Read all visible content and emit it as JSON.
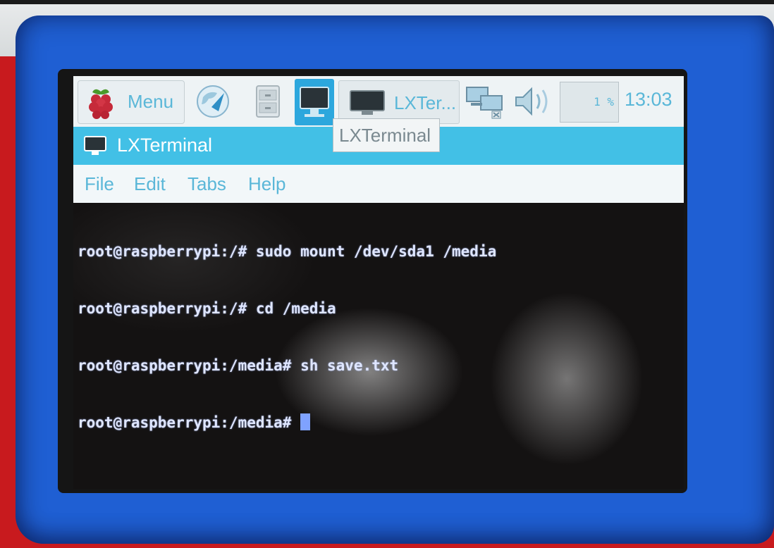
{
  "taskbar": {
    "menu_label": "Menu",
    "task_label": "LXTer...",
    "cpu_usage": "1 %",
    "clock": "13:03",
    "icons": [
      "raspberry-pi-icon",
      "web-browser-icon",
      "file-manager-icon",
      "terminal-icon",
      "network-icon",
      "volume-icon"
    ]
  },
  "tooltip": {
    "text": "LXTerminal"
  },
  "window": {
    "title": "LXTerminal",
    "menu": [
      "File",
      "Edit",
      "Tabs",
      "Help"
    ]
  },
  "terminal": {
    "lines": [
      "root@raspberrypi:/# sudo mount /dev/sda1 /media",
      "root@raspberrypi:/# cd /media",
      "root@raspberrypi:/media# sh save.txt",
      "root@raspberrypi:/media# "
    ]
  },
  "colors": {
    "bezel": "#1f5fd3",
    "accent": "#42c0e6",
    "label": "#5ab7d8",
    "terminal_text": "#dfe6ff"
  }
}
